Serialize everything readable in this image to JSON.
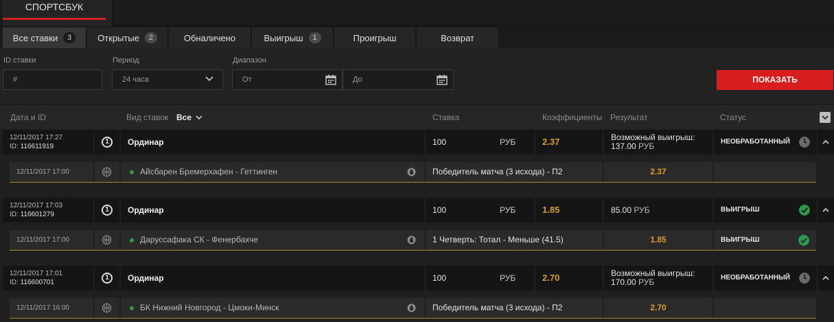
{
  "app": {
    "title": "СПОРТСБУК"
  },
  "tabs": [
    {
      "label": "Все ставки",
      "count": "3"
    },
    {
      "label": "Открытые",
      "count": "2"
    },
    {
      "label": "Обналичено",
      "count": ""
    },
    {
      "label": "Выигрыш",
      "count": "1"
    },
    {
      "label": "Проигрыш",
      "count": ""
    },
    {
      "label": "Возврат",
      "count": ""
    }
  ],
  "filters": {
    "bet_id_label": "ID ставки",
    "bet_id_placeholder": "#",
    "period_label": "Период",
    "period_value": "24 часа",
    "range_label": "Диапазон",
    "from_placeholder": "От",
    "to_placeholder": "До",
    "show_button": "ПОКАЗАТЬ"
  },
  "table": {
    "headers": {
      "date_id": "Дата и ID",
      "bet_type": "Вид ставок",
      "bet_type_filter": "Все",
      "stake": "Ставка",
      "odds": "Коэффициенты",
      "result": "Результат",
      "status": "Статус"
    }
  },
  "colors": {
    "accent": "#d71d1d",
    "odds": "#d79d2f",
    "success": "#2d9a4b"
  },
  "bets": [
    {
      "date": "12/11/2017 17:27",
      "id_prefix": "ID:",
      "id": "116611919",
      "num": "1",
      "type": "Ординар",
      "stake": "100",
      "currency": "РУБ",
      "odds": "2.37",
      "result_line1": "Возможный выигрыш:",
      "result_amount": "137.00",
      "result_currency": "РУБ",
      "status": "НЕОБРАБОТАННЫЙ",
      "status_icon": "clock-icon",
      "selection": {
        "date": "12/11/2017 17:00",
        "sport_icon": "basketball-icon",
        "match": "Айсбарен Бремерхафен - Геттинген",
        "market": "Победитель матча (3 исхода) - П2",
        "odds": "2.37",
        "status": ""
      }
    },
    {
      "date": "12/11/2017 17:03",
      "id_prefix": "ID:",
      "id": "116601279",
      "num": "1",
      "type": "Ординар",
      "stake": "100",
      "currency": "РУБ",
      "odds": "1.85",
      "result_line1": "",
      "result_amount": "85.00",
      "result_currency": "РУБ",
      "status": "ВЫИГРЫШ",
      "status_icon": "check-icon",
      "selection": {
        "date": "12/11/2017 17:00",
        "sport_icon": "basketball-icon",
        "match": "Даруссафака СК - Фенербахче",
        "market": "1 Четверть: Тотал - Меньше (41.5)",
        "odds": "1.85",
        "status": "ВЫИГРЫШ"
      }
    },
    {
      "date": "12/11/2017 17:01",
      "id_prefix": "ID:",
      "id": "116600701",
      "num": "1",
      "type": "Ординар",
      "stake": "100",
      "currency": "РУБ",
      "odds": "2.70",
      "result_line1": "Возможный выигрыш:",
      "result_amount": "170.00",
      "result_currency": "РУБ",
      "status": "НЕОБРАБОТАННЫЙ",
      "status_icon": "clock-icon",
      "selection": {
        "date": "12/11/2017 16:00",
        "sport_icon": "basketball-icon",
        "match": "БК Нижний Новгород - Цмоки-Минск",
        "market": "Победитель матча (3 исхода) - П2",
        "odds": "2.70",
        "status": ""
      }
    }
  ]
}
